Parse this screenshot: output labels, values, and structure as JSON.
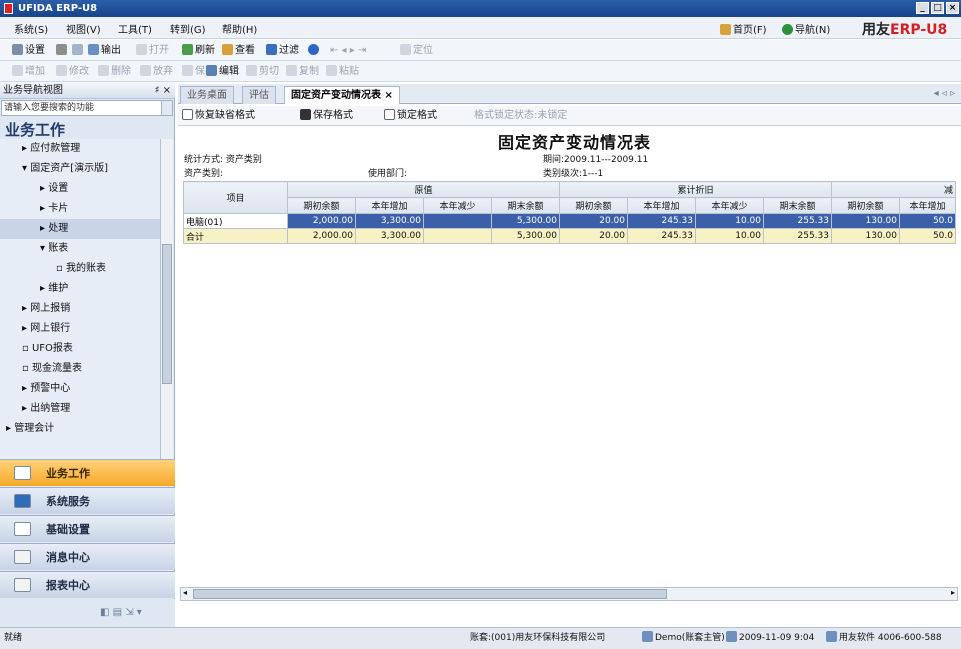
{
  "window": {
    "title": "UFIDA ERP-U8",
    "min": "_",
    "max": "□",
    "close": "×"
  },
  "menu": [
    "系统(S)",
    "视图(V)",
    "工具(T)",
    "转到(G)",
    "帮助(H)"
  ],
  "topright": {
    "home": "首页(F)",
    "nav": "导航(N)",
    "logo_brand": "用友",
    "logo_erp": "ERP",
    "logo_suffix": "-U8"
  },
  "toolbar1": {
    "items": [
      "设置",
      "打印",
      "预览",
      "输出",
      "打开",
      "刷新",
      "查看",
      "过滤",
      "定位"
    ]
  },
  "toolbar2": {
    "items": [
      "增加",
      "修改",
      "删除",
      "放弃",
      "保存",
      "编辑",
      "剪切",
      "复制",
      "粘贴"
    ]
  },
  "nav": {
    "header": "业务导航视图",
    "pin": "♯ ×",
    "search_placeholder": "请输入您要搜索的功能",
    "section": "业务工作",
    "tree": [
      {
        "label": "应付款管理",
        "indent": 1,
        "marker": "▸"
      },
      {
        "label": "固定资产[演示版]",
        "indent": 1,
        "marker": "▾"
      },
      {
        "label": "设置",
        "indent": 2,
        "marker": "▸"
      },
      {
        "label": "卡片",
        "indent": 2,
        "marker": "▸"
      },
      {
        "label": "处理",
        "indent": 2,
        "marker": "▸",
        "selected": true
      },
      {
        "label": "账表",
        "indent": 2,
        "marker": "▾"
      },
      {
        "label": "我的账表",
        "indent": 3,
        "marker": "▫"
      },
      {
        "label": "维护",
        "indent": 2,
        "marker": "▸"
      },
      {
        "label": "网上报销",
        "indent": 1,
        "marker": "▸"
      },
      {
        "label": "网上银行",
        "indent": 1,
        "marker": "▸"
      },
      {
        "label": "UFO报表",
        "indent": 1,
        "marker": "▫"
      },
      {
        "label": "现金流量表",
        "indent": 1,
        "marker": "▫"
      },
      {
        "label": "预警中心",
        "indent": 1,
        "marker": "▸"
      },
      {
        "label": "出纳管理",
        "indent": 1,
        "marker": "▸"
      },
      {
        "label": "管理会计",
        "indent": 0,
        "marker": "▸"
      }
    ],
    "buttons": [
      {
        "label": "业务工作",
        "active": true
      },
      {
        "label": "系统服务"
      },
      {
        "label": "基础设置"
      },
      {
        "label": "消息中心"
      },
      {
        "label": "报表中心"
      }
    ]
  },
  "tabs": [
    {
      "label": "业务桌面"
    },
    {
      "label": "评估"
    },
    {
      "label": "固定资产变动情况表",
      "active": true,
      "close": "×"
    }
  ],
  "tab_nav": "◂ ◃ ▹",
  "report_toolbar": {
    "restore": "恢复缺省格式",
    "save": "保存格式",
    "lock": "锁定格式",
    "status": "格式锁定状态:未锁定"
  },
  "report": {
    "title": "固定资产变动情况表",
    "stat_method": "统计方式: 资产类别",
    "asset_category": "资产类别:",
    "dept": "使用部门:",
    "period": "期间:2009.11---2009.11",
    "level": "类别级次:1---1",
    "group_headers": [
      "原值",
      "累计折旧",
      "减"
    ],
    "item_header": "项目",
    "sub_headers": [
      "期初余额",
      "本年增加",
      "本年减少",
      "期末余额",
      "期初余额",
      "本年增加",
      "本年减少",
      "期末余额",
      "期初余额",
      "本年增加"
    ],
    "rows": [
      {
        "item": "电脑(01)",
        "values": [
          "2,000.00",
          "3,300.00",
          "",
          "5,300.00",
          "20.00",
          "245.33",
          "10.00",
          "255.33",
          "130.00",
          "50.0"
        ]
      },
      {
        "item": "合计",
        "values": [
          "2,000.00",
          "3,300.00",
          "",
          "5,300.00",
          "20.00",
          "245.33",
          "10.00",
          "255.33",
          "130.00",
          "50.0"
        ]
      }
    ]
  },
  "status": {
    "ready": "就绪",
    "account": "账套:(001)用友环保科技有限公司",
    "user": "Demo(账套主管)",
    "date": "2009-11-09 9:04",
    "hotline": "用友软件 4006-600-588"
  }
}
